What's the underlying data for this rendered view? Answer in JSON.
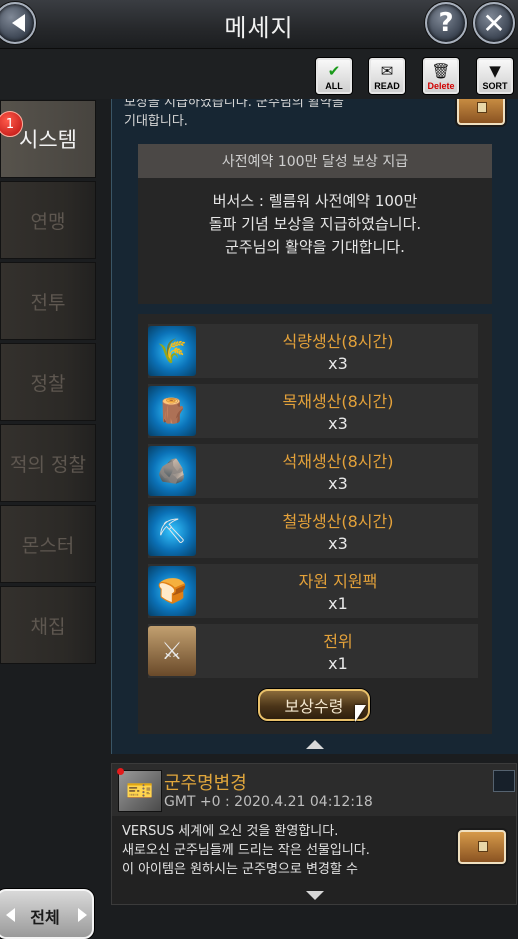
{
  "header": {
    "title": "메세지"
  },
  "toolbar": {
    "all_label": "ALL",
    "read_label": "READ",
    "delete_label": "Delete",
    "sort_label": "SORT"
  },
  "sidebar": {
    "badge_count": "1",
    "items": [
      {
        "label": "시스템"
      },
      {
        "label": "연맹"
      },
      {
        "label": "전투"
      },
      {
        "label": "정찰"
      },
      {
        "label": "적의 정찰"
      },
      {
        "label": "몬스터"
      },
      {
        "label": "채집"
      }
    ]
  },
  "message": {
    "intro_lines": [
      "보상을 지급하였습니다. 군주님의 활약을",
      "기대합니다."
    ],
    "notice_title": "사전예약 100만 달성 보상 지급",
    "notice_lines": [
      "버서스 : 렐름워 사전예약 100만",
      "돌파 기념 보상을 지급하였습니다.",
      "군주님의 활약을 기대합니다."
    ],
    "rewards": [
      {
        "name": "식량생산(8시간)",
        "qty": "x3",
        "icon": "food-production-icon"
      },
      {
        "name": "목재생산(8시간)",
        "qty": "x3",
        "icon": "wood-production-icon"
      },
      {
        "name": "석재생산(8시간)",
        "qty": "x3",
        "icon": "stone-production-icon"
      },
      {
        "name": "철광생산(8시간)",
        "qty": "x3",
        "icon": "iron-production-icon"
      },
      {
        "name": "자원 지원팩",
        "qty": "x1",
        "icon": "resource-pack-icon"
      },
      {
        "name": "전위",
        "qty": "x1",
        "icon": "hero-portrait-icon"
      }
    ],
    "claim_label": "보상수령"
  },
  "message2": {
    "title": "군주명변경",
    "time": "GMT +0 : 2020.4.21 04:12:18",
    "lines": [
      "VERSUS 세계에 오신 것을 환영합니다.",
      "새로오신 군주님들께 드리는 작은 선물입니다.",
      "이 아이템은 원하시는 군주명으로 변경할 수"
    ]
  },
  "filter": {
    "label": "전체"
  },
  "colors": {
    "reward_name": "#e3a13a",
    "accent_gold": "#e8c06a",
    "badge_red": "#d01a1a"
  }
}
